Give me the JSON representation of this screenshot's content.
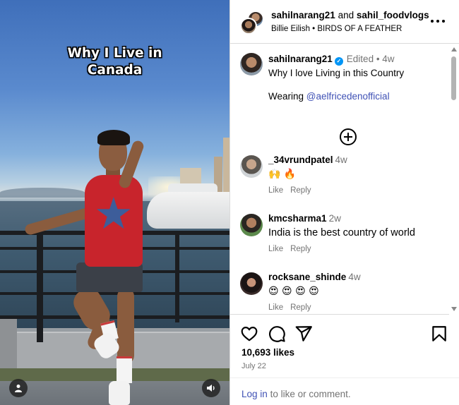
{
  "media": {
    "overlay_line1": "Why I Live in",
    "overlay_line2": "Canada",
    "user_icon": "user-icon",
    "sound_icon": "speaker-icon"
  },
  "header": {
    "user1": "sahilnarang21",
    "joiner": "and",
    "user2": "sahil_foodvlogs",
    "audio": "Billie Eilish • BIRDS OF A FEATHER",
    "more_icon": "more-horizontal-icon"
  },
  "caption": {
    "username": "sahilnarang21",
    "verified_icon": "verified-badge-icon",
    "meta": "Edited • 4w",
    "text": "Why I love Living in this Country",
    "wearing_label": "Wearing",
    "mention": "@aelfricedenofficial",
    "load_more_icon": "plus-circle-icon"
  },
  "comments": [
    {
      "username": "_34vrundpatel",
      "time": "4w",
      "text": "🙌 🔥",
      "like": "Like",
      "reply": "Reply"
    },
    {
      "username": "kmcsharma1",
      "time": "2w",
      "text": "India is the best country of world",
      "like": "Like",
      "reply": "Reply"
    },
    {
      "username": "rocksane_shinde",
      "time": "4w",
      "text": "😍 😍 😍 😍",
      "like": "Like",
      "reply": "Reply"
    }
  ],
  "actions": {
    "icons": [
      "heart-icon",
      "comment-icon",
      "share-icon",
      "bookmark-icon"
    ],
    "likes": "10,693 likes",
    "date": "July 22",
    "login_link": "Log in",
    "login_rest": "to like or comment."
  },
  "colors": {
    "link_blue": "#3f51b5",
    "verified_blue": "#0095f6",
    "muted_gray": "#737373",
    "border": "#dbdbdb"
  }
}
